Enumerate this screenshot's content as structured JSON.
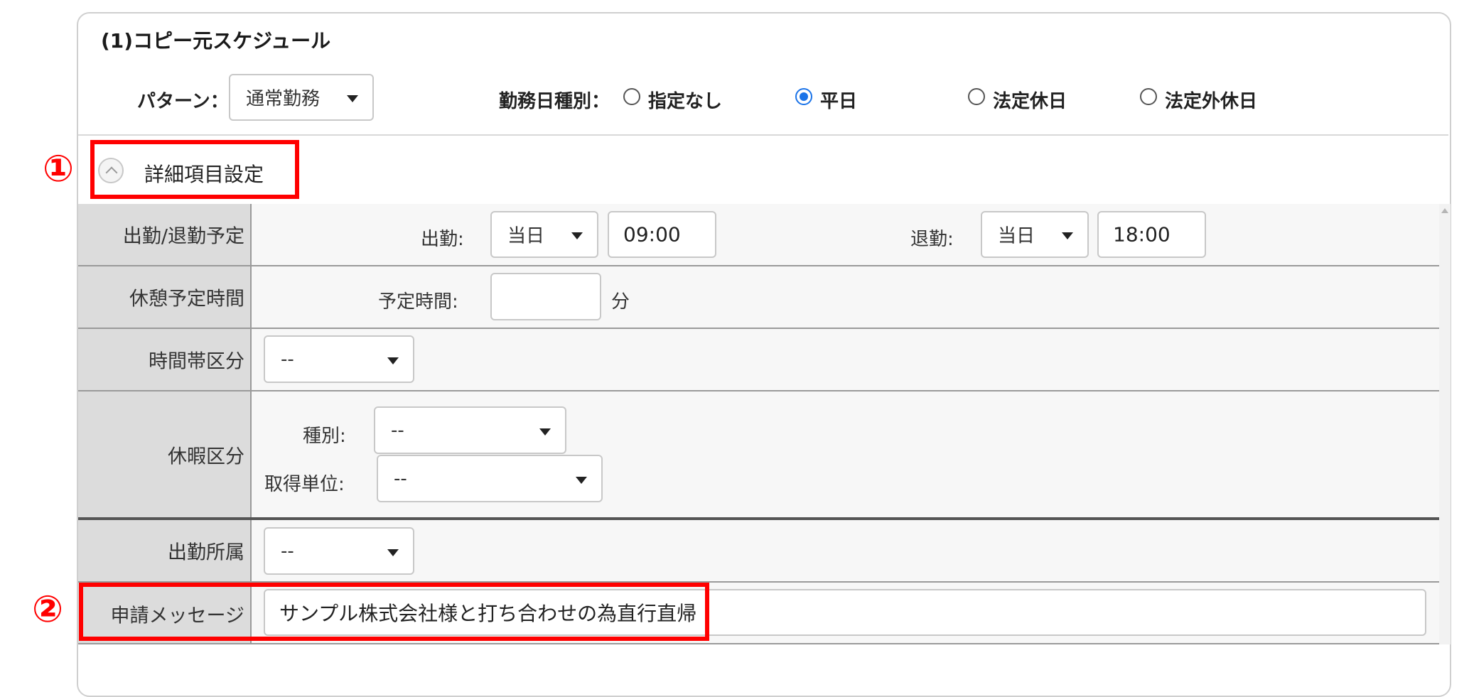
{
  "section": {
    "title": "(1)コピー元スケジュール"
  },
  "pattern": {
    "label": "パターン：",
    "value": "通常勤務"
  },
  "workday_type": {
    "label": "勤務日種別：",
    "options": [
      {
        "label": "指定なし",
        "checked": false
      },
      {
        "label": "平日",
        "checked": true
      },
      {
        "label": "法定休日",
        "checked": false
      },
      {
        "label": "法定外休日",
        "checked": false
      }
    ]
  },
  "annotations": {
    "one": "①",
    "two": "②",
    "color": "#ff0000"
  },
  "detail_settings": {
    "label": "詳細項目設定",
    "icon": "chevron-up-icon"
  },
  "rows": {
    "attendance": {
      "header": "出勤/退勤予定",
      "in_label": "出勤:",
      "in_day": "当日",
      "in_time": "09:00",
      "out_label": "退勤:",
      "out_day": "当日",
      "out_time": "18:00"
    },
    "break": {
      "header": "休憩予定時間",
      "label": "予定時間:",
      "value": "",
      "unit": "分"
    },
    "timeband": {
      "header": "時間帯区分",
      "value": "--"
    },
    "leave": {
      "header": "休暇区分",
      "type_label": "種別:",
      "type_value": "--",
      "unit_label": "取得単位:",
      "unit_value": "--"
    },
    "affiliation": {
      "header": "出勤所属",
      "value": "--"
    },
    "message": {
      "header": "申請メッセージ",
      "value": "サンプル株式会社様と打ち合わせの為直行直帰"
    }
  },
  "colors": {
    "accent": "#1a73e8",
    "header_bg": "#dcdcdc",
    "body_bg": "#f7f7f7"
  }
}
